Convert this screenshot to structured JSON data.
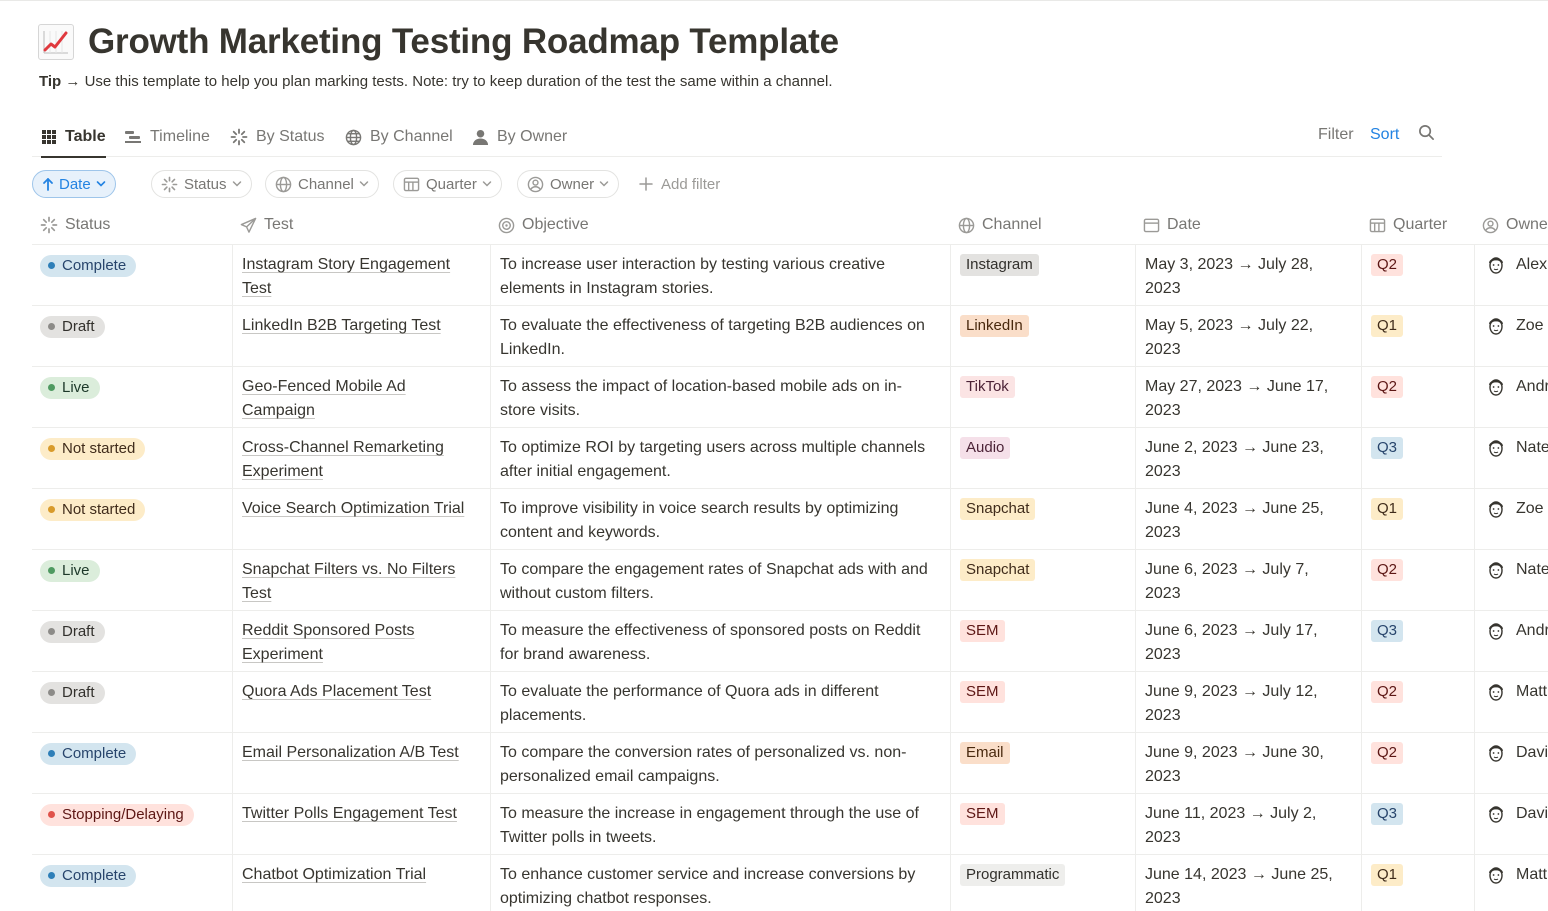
{
  "page": {
    "title": "Growth Marketing Testing Roadmap Template",
    "title_icon": "chart-increasing-icon",
    "tip_label": "Tip",
    "tip_arrow": "→",
    "tip_text": "Use this template to help you plan marking tests. Note: try to keep duration of the test the same within a channel."
  },
  "views": {
    "tabs": [
      {
        "label": "Table",
        "icon": "table-grid-icon",
        "active": true
      },
      {
        "label": "Timeline",
        "icon": "timeline-icon",
        "active": false
      },
      {
        "label": "By Status",
        "icon": "status-spinner-icon",
        "active": false
      },
      {
        "label": "By Channel",
        "icon": "globe-icon",
        "active": false
      },
      {
        "label": "By Owner",
        "icon": "person-icon",
        "active": false
      }
    ],
    "actions": {
      "filter": "Filter",
      "sort": "Sort",
      "search_icon": "search-icon"
    }
  },
  "filters": {
    "sort_chip": {
      "label": "Date",
      "icon": "arrow-up-icon"
    },
    "chips": [
      {
        "label": "Status",
        "icon": "status-spinner-icon"
      },
      {
        "label": "Channel",
        "icon": "globe-icon"
      },
      {
        "label": "Quarter",
        "icon": "calendar-icon"
      },
      {
        "label": "Owner",
        "icon": "person-circle-icon"
      }
    ],
    "add_filter": "Add filter"
  },
  "table": {
    "columns": [
      {
        "key": "status",
        "label": "Status",
        "icon": "status-spinner-icon"
      },
      {
        "key": "test",
        "label": "Test",
        "icon": "paper-plane-icon"
      },
      {
        "key": "objective",
        "label": "Objective",
        "icon": "target-icon"
      },
      {
        "key": "channel",
        "label": "Channel",
        "icon": "globe-icon"
      },
      {
        "key": "date",
        "label": "Date",
        "icon": "calendar-icon"
      },
      {
        "key": "quarter",
        "label": "Quarter",
        "icon": "calendar-icon"
      },
      {
        "key": "owner",
        "label": "Owne",
        "icon": "person-circle-icon"
      }
    ],
    "rows": [
      {
        "status": "Complete",
        "test_l1": "Instagram Story Engagement",
        "test_l2": "Test",
        "obj_l1": "To increase user interaction by testing various creative",
        "obj_l2": "elements in Instagram stories.",
        "channel": "Instagram",
        "date_l1": "May 3, 2023 → July 28,",
        "date_l2": "2023",
        "quarter": "Q2",
        "owner": "Alex"
      },
      {
        "status": "Draft",
        "test_l1": "LinkedIn B2B Targeting Test",
        "test_l2": "",
        "obj_l1": "To evaluate the effectiveness of targeting B2B audiences on",
        "obj_l2": "LinkedIn.",
        "channel": "LinkedIn",
        "date_l1": "May 5, 2023 → July 22,",
        "date_l2": "2023",
        "quarter": "Q1",
        "owner": "Zoe L"
      },
      {
        "status": "Live",
        "test_l1": "Geo-Fenced Mobile Ad",
        "test_l2": "Campaign",
        "obj_l1": "To assess the impact of location-based mobile ads on in-",
        "obj_l2": "store visits.",
        "channel": "TikTok",
        "date_l1": "May 27, 2023 → June 17,",
        "date_l2": "2023",
        "quarter": "Q2",
        "owner": "Andr"
      },
      {
        "status": "Not started",
        "test_l1": "Cross-Channel Remarketing",
        "test_l2": "Experiment",
        "obj_l1": "To optimize ROI by targeting users across multiple channels",
        "obj_l2": "after initial engagement.",
        "channel": "Audio",
        "date_l1": "June 2, 2023 → June 23,",
        "date_l2": "2023",
        "quarter": "Q3",
        "owner": "Nate"
      },
      {
        "status": "Not started",
        "test_l1": "Voice Search Optimization Trial",
        "test_l2": "",
        "obj_l1": "To improve visibility in voice search results by optimizing",
        "obj_l2": "content and keywords.",
        "channel": "Snapchat",
        "date_l1": "June 4, 2023 → June 25,",
        "date_l2": "2023",
        "quarter": "Q1",
        "owner": "Zoe L"
      },
      {
        "status": "Live",
        "test_l1": "Snapchat Filters vs. No Filters",
        "test_l2": "Test",
        "obj_l1": "To compare the engagement rates of Snapchat ads with and",
        "obj_l2": "without custom filters.",
        "channel": "Snapchat",
        "date_l1": "June 6, 2023 → July 7,",
        "date_l2": "2023",
        "quarter": "Q2",
        "owner": "Nate"
      },
      {
        "status": "Draft",
        "test_l1": "Reddit Sponsored Posts",
        "test_l2": "Experiment",
        "obj_l1": "To measure the effectiveness of sponsored posts on Reddit",
        "obj_l2": "for brand awareness.",
        "channel": "SEM",
        "date_l1": "June 6, 2023 → July 17,",
        "date_l2": "2023",
        "quarter": "Q3",
        "owner": "Andr"
      },
      {
        "status": "Draft",
        "test_l1": "Quora Ads Placement Test",
        "test_l2": "",
        "obj_l1": "To evaluate the performance of Quora ads in different",
        "obj_l2": "placements.",
        "channel": "SEM",
        "date_l1": "June 9, 2023 → July 12,",
        "date_l2": "2023",
        "quarter": "Q2",
        "owner": "Matt"
      },
      {
        "status": "Complete",
        "test_l1": "Email Personalization A/B Test",
        "test_l2": "",
        "obj_l1": "To compare the conversion rates of personalized vs. non-",
        "obj_l2": "personalized email campaigns.",
        "channel": "Email",
        "date_l1": "June 9, 2023 → June 30,",
        "date_l2": "2023",
        "quarter": "Q2",
        "owner": "Davic"
      },
      {
        "status": "Stopping/Delaying",
        "test_l1": "Twitter Polls Engagement Test",
        "test_l2": "",
        "obj_l1": "To measure the increase in engagement through the use of",
        "obj_l2": "Twitter polls in tweets.",
        "channel": "SEM",
        "date_l1": "June 11, 2023 → July 2,",
        "date_l2": "2023",
        "quarter": "Q3",
        "owner": "Davic"
      },
      {
        "status": "Complete",
        "test_l1": "Chatbot Optimization Trial",
        "test_l2": "",
        "obj_l1": "To enhance customer service and increase conversions by",
        "obj_l2": "optimizing chatbot responses.",
        "channel": "Programmatic",
        "date_l1": "June 14, 2023 → June 25,",
        "date_l2": "2023",
        "quarter": "Q1",
        "owner": "Matt"
      }
    ]
  },
  "colors": {
    "status": {
      "Complete": {
        "bg": "#d3e5ef",
        "dot": "#2e7fb8",
        "text": "#28456c"
      },
      "Draft": {
        "bg": "#e3e2e0",
        "dot": "#8c8b88",
        "text": "#32302c"
      },
      "Live": {
        "bg": "#dbeddb",
        "dot": "#4f9a61",
        "text": "#1c3829"
      },
      "Not started": {
        "bg": "#fdecc8",
        "dot": "#d89b2b",
        "text": "#402c1b"
      },
      "Stopping/Delaying": {
        "bg": "#ffe2dd",
        "dot": "#e0524a",
        "text": "#5d1715"
      }
    },
    "channel": {
      "Instagram": {
        "bg": "#e3e2e0",
        "text": "#32302c"
      },
      "LinkedIn": {
        "bg": "#fadec9",
        "text": "#49290e"
      },
      "TikTok": {
        "bg": "#fbe4e4",
        "text": "#4c2337"
      },
      "Audio": {
        "bg": "#f5e0e9",
        "text": "#4c2337"
      },
      "Snapchat": {
        "bg": "#fdecc8",
        "text": "#402c1b"
      },
      "SEM": {
        "bg": "#ffe2dd",
        "text": "#5d1715"
      },
      "Email": {
        "bg": "#fadec9",
        "text": "#49290e"
      },
      "Programmatic": {
        "bg": "#eeeeec",
        "text": "#32302c"
      }
    },
    "quarter": {
      "Q1": {
        "bg": "#fdecc8",
        "text": "#402c1b"
      },
      "Q2": {
        "bg": "#ffe2dd",
        "text": "#5d1715"
      },
      "Q3": {
        "bg": "#d3e5ef",
        "text": "#28456c"
      }
    },
    "accent": "#2383e2"
  }
}
